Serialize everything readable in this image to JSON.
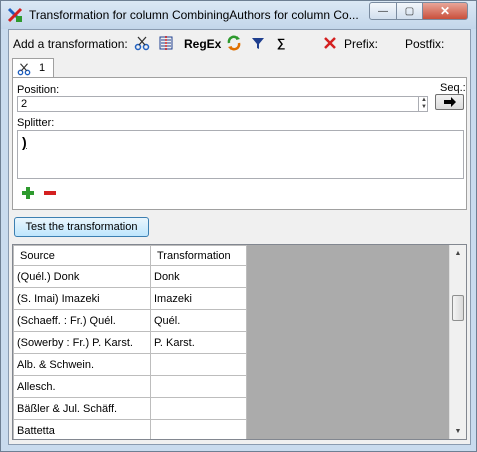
{
  "window": {
    "title": "Transformation for column CombiningAuthors for column Co...",
    "controls": {
      "minimize": "—",
      "maximize": "▢",
      "close": "✕"
    }
  },
  "toolbar": {
    "add_label": "Add a transformation:",
    "regex_label": "RegEx",
    "sum_label": "∑",
    "prefix_label": "Prefix:",
    "postfix_label": "Postfix:",
    "icons": [
      "scissors-icon",
      "split-columns-icon",
      "regex",
      "replace-icon",
      "filter-icon",
      "sum-icon",
      "delete-x-icon"
    ]
  },
  "tab": {
    "label": "1"
  },
  "position": {
    "label": "Position:",
    "value": "2"
  },
  "sequence": {
    "label": "Seq.:"
  },
  "splitter": {
    "label": "Splitter:",
    "value": ")"
  },
  "test_button": {
    "label": "Test the transformation"
  },
  "grid": {
    "headers": [
      "Source",
      "Transformation"
    ],
    "rows": [
      [
        "(Quél.) Donk",
        "Donk"
      ],
      [
        "(S. Imai) Imazeki",
        "Imazeki"
      ],
      [
        "(Schaeff. : Fr.) Quél.",
        "Quél."
      ],
      [
        "(Sowerby : Fr.) P. Karst.",
        "P. Karst."
      ],
      [
        "Alb. & Schwein.",
        ""
      ],
      [
        "Allesch.",
        ""
      ],
      [
        "Bäßler & Jul. Schäff.",
        ""
      ],
      [
        "Battetta",
        ""
      ]
    ]
  },
  "colors": {
    "accent_green": "#2e9a2e",
    "accent_red": "#d42020",
    "title_bg": "#c9dbee"
  }
}
